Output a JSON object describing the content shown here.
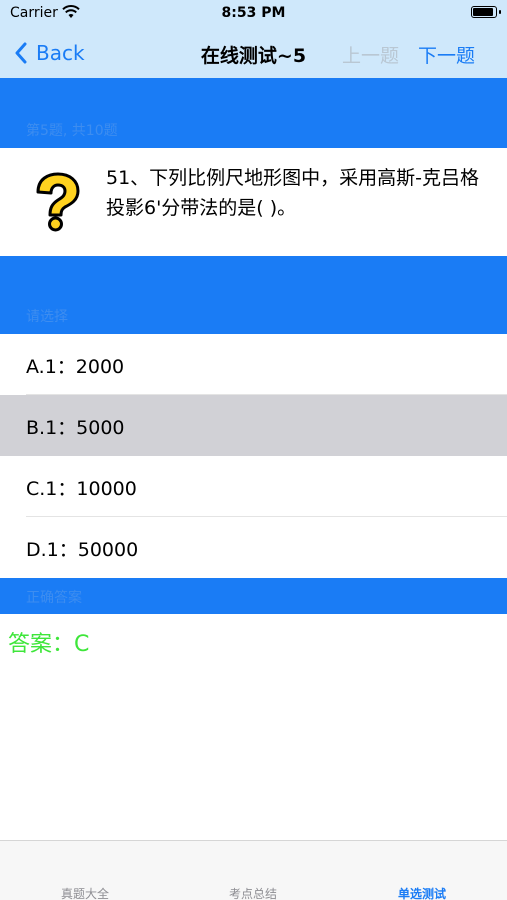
{
  "status_bar": {
    "carrier": "Carrier",
    "time": "8:53 PM"
  },
  "nav": {
    "back_label": "Back",
    "title": "在线测试~5",
    "prev_label": "上一题",
    "next_label": "下一题"
  },
  "sections": {
    "question_header": "第5题, 共10题",
    "options_header": "请选择",
    "answer_header": "正确答案"
  },
  "question": {
    "text": "51、下列比例尺地形图中，采用高斯-克吕格投影6'分带法的是( )。"
  },
  "options": [
    {
      "label": "A.1：2000"
    },
    {
      "label": "B.1：5000",
      "selected": true
    },
    {
      "label": "C.1：10000"
    },
    {
      "label": "D.1：50000"
    }
  ],
  "answer": {
    "text": "答案：C"
  },
  "tabs": [
    {
      "label": "真题大全"
    },
    {
      "label": "考点总结"
    },
    {
      "label": "单选测试",
      "active": true
    }
  ],
  "colors": {
    "accent": "#1a7cf5",
    "nav_background": "#cfe8fb",
    "selected_row": "#d1d1d6",
    "answer_green": "#3ee63a",
    "disabled_text": "#b9c7d3"
  }
}
